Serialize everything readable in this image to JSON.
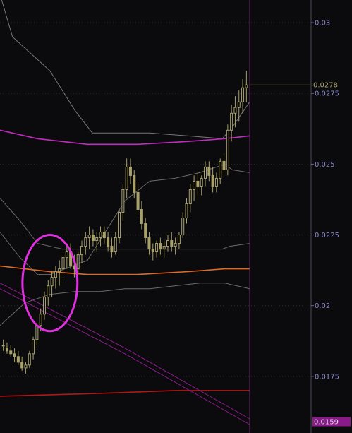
{
  "chart_data": {
    "type": "candlestick",
    "y_axis": {
      "position": "right",
      "ticks": [
        "0.03",
        "0.0275",
        "0.025",
        "0.0225",
        "0.02",
        "0.0175"
      ],
      "range": [
        0.0155,
        0.0308
      ],
      "grid": "dotted-horizontal",
      "current_price_label": "0.0278",
      "highlighted_price_label": "0.0159"
    },
    "x_axis": {
      "labels": []
    },
    "candles": [
      [
        0.0186,
        0.0188,
        0.0184,
        0.0186
      ],
      [
        0.0185,
        0.0187,
        0.0183,
        0.0184
      ],
      [
        0.0184,
        0.0186,
        0.0182,
        0.0183
      ],
      [
        0.0183,
        0.0185,
        0.018,
        0.0182
      ],
      [
        0.0182,
        0.0184,
        0.0179,
        0.018
      ],
      [
        0.018,
        0.0182,
        0.0177,
        0.0178
      ],
      [
        0.0178,
        0.018,
        0.0176,
        0.0179
      ],
      [
        0.0179,
        0.0184,
        0.0178,
        0.0183
      ],
      [
        0.0183,
        0.0189,
        0.0181,
        0.0188
      ],
      [
        0.0188,
        0.0194,
        0.0186,
        0.0193
      ],
      [
        0.0193,
        0.0199,
        0.0191,
        0.0197
      ],
      [
        0.0197,
        0.0205,
        0.0195,
        0.0203
      ],
      [
        0.0203,
        0.0209,
        0.02,
        0.0207
      ],
      [
        0.0207,
        0.0212,
        0.0203,
        0.021
      ],
      [
        0.021,
        0.0214,
        0.0206,
        0.0212
      ],
      [
        0.0212,
        0.0216,
        0.0207,
        0.0213
      ],
      [
        0.0213,
        0.0219,
        0.0209,
        0.0217
      ],
      [
        0.0217,
        0.0222,
        0.0213,
        0.0219
      ],
      [
        0.0219,
        0.0222,
        0.0213,
        0.0214
      ],
      [
        0.0214,
        0.0218,
        0.021,
        0.0213
      ],
      [
        0.0213,
        0.0219,
        0.0211,
        0.0218
      ],
      [
        0.0218,
        0.0223,
        0.0215,
        0.0221
      ],
      [
        0.0221,
        0.0226,
        0.0218,
        0.0224
      ],
      [
        0.0224,
        0.0228,
        0.022,
        0.0225
      ],
      [
        0.0225,
        0.0227,
        0.0221,
        0.0223
      ],
      [
        0.0223,
        0.0226,
        0.0219,
        0.0224
      ],
      [
        0.0224,
        0.0228,
        0.0221,
        0.0226
      ],
      [
        0.0226,
        0.0228,
        0.0222,
        0.0224
      ],
      [
        0.0224,
        0.0226,
        0.0219,
        0.0221
      ],
      [
        0.0221,
        0.0224,
        0.0217,
        0.0219
      ],
      [
        0.0219,
        0.0226,
        0.0218,
        0.0224
      ],
      [
        0.0224,
        0.0234,
        0.0222,
        0.0233
      ],
      [
        0.0233,
        0.0243,
        0.023,
        0.0241
      ],
      [
        0.0241,
        0.0252,
        0.0238,
        0.0249
      ],
      [
        0.0249,
        0.0252,
        0.0243,
        0.0246
      ],
      [
        0.0246,
        0.0248,
        0.0238,
        0.024
      ],
      [
        0.024,
        0.0243,
        0.0232,
        0.0234
      ],
      [
        0.0234,
        0.0237,
        0.0227,
        0.0229
      ],
      [
        0.0229,
        0.0231,
        0.0222,
        0.0224
      ],
      [
        0.0224,
        0.0226,
        0.0218,
        0.022
      ],
      [
        0.022,
        0.0222,
        0.0216,
        0.0219
      ],
      [
        0.0219,
        0.0223,
        0.0217,
        0.0222
      ],
      [
        0.0222,
        0.0224,
        0.0218,
        0.022
      ],
      [
        0.022,
        0.0223,
        0.0217,
        0.0221
      ],
      [
        0.0221,
        0.0225,
        0.0219,
        0.0223
      ],
      [
        0.0223,
        0.0226,
        0.0219,
        0.0221
      ],
      [
        0.0221,
        0.0224,
        0.0218,
        0.0222
      ],
      [
        0.0222,
        0.0226,
        0.022,
        0.0225
      ],
      [
        0.0225,
        0.0233,
        0.0224,
        0.0231
      ],
      [
        0.0231,
        0.0238,
        0.0229,
        0.0236
      ],
      [
        0.0236,
        0.0243,
        0.0233,
        0.0241
      ],
      [
        0.0241,
        0.0246,
        0.0237,
        0.0244
      ],
      [
        0.0244,
        0.0247,
        0.0239,
        0.0242
      ],
      [
        0.0242,
        0.0246,
        0.0239,
        0.0245
      ],
      [
        0.0245,
        0.0251,
        0.0242,
        0.0249
      ],
      [
        0.0249,
        0.0251,
        0.0244,
        0.0246
      ],
      [
        0.0246,
        0.0249,
        0.024,
        0.0242
      ],
      [
        0.0242,
        0.0247,
        0.024,
        0.0245
      ],
      [
        0.0245,
        0.0252,
        0.0243,
        0.0251
      ],
      [
        0.0251,
        0.0254,
        0.0246,
        0.0248
      ],
      [
        0.0248,
        0.0264,
        0.0246,
        0.0262
      ],
      [
        0.0262,
        0.0271,
        0.0258,
        0.0268
      ],
      [
        0.0268,
        0.0274,
        0.0263,
        0.027
      ],
      [
        0.027,
        0.0276,
        0.0265,
        0.0272
      ],
      [
        0.0272,
        0.028,
        0.0268,
        0.0277
      ],
      [
        0.0277,
        0.0283,
        0.0272,
        0.0278
      ]
    ],
    "indicator_lines": [
      {
        "name": "",
        "color": "#7a7676",
        "points": [
          [
            0.0,
            0.031
          ],
          [
            0.05,
            0.0295
          ],
          [
            0.2,
            0.0283
          ],
          [
            0.3,
            0.0269
          ],
          [
            0.37,
            0.0261
          ],
          [
            0.6,
            0.0261
          ],
          [
            0.75,
            0.026
          ],
          [
            0.89,
            0.0259
          ],
          [
            0.93,
            0.0263
          ],
          [
            1.0,
            0.0272
          ]
        ]
      },
      {
        "name": "",
        "color": "#6e6a6a",
        "points": [
          [
            0.0,
            0.0238
          ],
          [
            0.08,
            0.023
          ],
          [
            0.15,
            0.0222
          ],
          [
            0.25,
            0.022
          ],
          [
            0.35,
            0.022
          ],
          [
            0.5,
            0.022
          ],
          [
            0.6,
            0.022
          ],
          [
            0.7,
            0.022
          ],
          [
            0.8,
            0.022
          ],
          [
            0.89,
            0.022
          ],
          [
            0.92,
            0.0221
          ],
          [
            1.0,
            0.0222
          ]
        ]
      },
      {
        "name": "",
        "color": "#6e6a6a",
        "points": [
          [
            0.0,
            0.0226
          ],
          [
            0.08,
            0.0217
          ],
          [
            0.15,
            0.0211
          ],
          [
            0.2,
            0.0211
          ],
          [
            0.35,
            0.0216
          ],
          [
            0.5,
            0.0237
          ],
          [
            0.6,
            0.0244
          ],
          [
            0.7,
            0.0245
          ],
          [
            0.8,
            0.0247
          ],
          [
            0.9,
            0.025
          ],
          [
            0.93,
            0.0248
          ],
          [
            1.0,
            0.0247
          ]
        ]
      },
      {
        "name": "",
        "color": "#6e6a6a",
        "points": [
          [
            0.0,
            0.0193
          ],
          [
            0.1,
            0.0201
          ],
          [
            0.2,
            0.0204
          ],
          [
            0.3,
            0.0205
          ],
          [
            0.4,
            0.0205
          ],
          [
            0.5,
            0.0206
          ],
          [
            0.6,
            0.0206
          ],
          [
            0.7,
            0.0207
          ],
          [
            0.8,
            0.0208
          ],
          [
            0.9,
            0.0208
          ],
          [
            1.0,
            0.0206
          ]
        ]
      },
      {
        "name": "",
        "color": "#c02cc0",
        "points": [
          [
            0.0,
            0.0262
          ],
          [
            0.15,
            0.0259
          ],
          [
            0.35,
            0.0257
          ],
          [
            0.55,
            0.0257
          ],
          [
            0.75,
            0.0258
          ],
          [
            0.9,
            0.0259
          ],
          [
            1.0,
            0.026
          ]
        ]
      },
      {
        "name": "",
        "color": "#e06a22",
        "points": [
          [
            0.0,
            0.0214
          ],
          [
            0.2,
            0.0212
          ],
          [
            0.35,
            0.0211
          ],
          [
            0.55,
            0.0211
          ],
          [
            0.75,
            0.0212
          ],
          [
            0.9,
            0.0213
          ],
          [
            1.0,
            0.0213
          ]
        ]
      },
      {
        "name": "",
        "color": "#b01818",
        "points": [
          [
            0.0,
            0.0168
          ],
          [
            0.4,
            0.0169
          ],
          [
            0.7,
            0.017
          ],
          [
            1.0,
            0.017
          ]
        ]
      },
      {
        "name": "",
        "color": "#8c1e8c",
        "points": [
          [
            0.0,
            0.0208
          ],
          [
            0.5,
            0.0185
          ],
          [
            1.0,
            0.016
          ]
        ]
      },
      {
        "name": "",
        "color": "#8c1e8c",
        "points": [
          [
            0.0,
            0.0206
          ],
          [
            0.5,
            0.0183
          ],
          [
            1.0,
            0.0158
          ]
        ]
      }
    ],
    "annotations": [
      {
        "type": "ellipse",
        "color": "#e030e0",
        "center": [
          0.2,
          0.0208
        ],
        "radii": [
          0.11,
          0.0017
        ]
      }
    ],
    "colors": {
      "background": "#0b0a0c",
      "candle": "#a8a26a",
      "axis_text": "#8a88c8",
      "current_price": "#a8a26a",
      "highlight_box": "#8a1a8a",
      "grid": "#2c2c34"
    }
  }
}
